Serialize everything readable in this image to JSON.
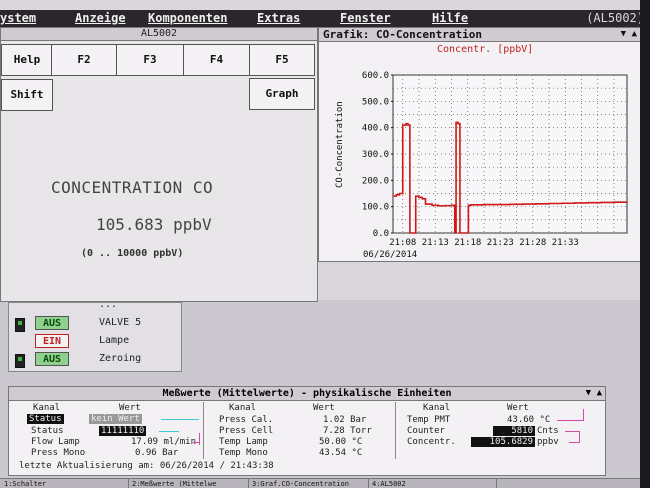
{
  "menubar": {
    "items": [
      "ystem",
      "Anzeige",
      "Komponenten",
      "Extras",
      "Fenster",
      "Hilfe"
    ],
    "right_label": "(AL5002)"
  },
  "al_window": {
    "title": "AL5002",
    "keys": [
      "Help",
      "F2",
      "F3",
      "F4",
      "F5",
      "Shift",
      "Graph"
    ],
    "concentration_label": "CONCENTRATION CO",
    "concentration_value": "105.683 ppbV",
    "range": "(0 .. 10000 ppbV)"
  },
  "valves": [
    {
      "state": "",
      "label": "...",
      "state_type": "aus"
    },
    {
      "state": "AUS",
      "label": "VALVE 5",
      "state_type": "aus"
    },
    {
      "state": "EIN",
      "label": "Lampe",
      "state_type": "ein"
    },
    {
      "state": "AUS",
      "label": "Zeroing",
      "state_type": "aus"
    }
  ],
  "chart_window": {
    "title": "Grafik: CO-Concentration",
    "subtitle": "Concentr. [ppbV]",
    "ylabel": "CO-Concentration",
    "date": "06/26/2014",
    "controls": [
      "▼",
      "▲"
    ]
  },
  "chart_data": {
    "type": "line",
    "title": "Grafik: CO-Concentration",
    "subtitle": "Concentr. [ppbV]",
    "ylabel": "CO-Concentration",
    "xlabel": "",
    "ylim": [
      0,
      600
    ],
    "yticks": [
      "0.0",
      "100.0",
      "200.0",
      "300.0",
      "400.0",
      "500.0",
      "600.0"
    ],
    "xticks": [
      "21:08",
      "21:13",
      "21:18",
      "21:23",
      "21:28",
      "21:33"
    ],
    "xlim_minutes": [
      0,
      36
    ],
    "grid": true,
    "series": [
      {
        "color": "#d01818",
        "x": [
          0,
          0.5,
          1,
          1.5,
          2,
          2.3,
          2.6,
          3.0,
          3.5,
          4.0,
          4.5,
          5,
          6,
          7,
          8,
          9,
          9.5,
          9.7,
          10.0,
          10.3,
          10.6,
          10.9,
          11.2,
          11.6,
          12,
          14,
          16,
          18,
          20,
          22,
          24,
          26,
          28,
          30,
          32,
          34,
          36
        ],
        "y": [
          140,
          145,
          150,
          410,
          415,
          410,
          0,
          0,
          140,
          135,
          130,
          110,
          105,
          103,
          104,
          105,
          0,
          420,
          415,
          0,
          0,
          0,
          0,
          105,
          107,
          108,
          108,
          109,
          110,
          111,
          112,
          113,
          114,
          115,
          116,
          117,
          118
        ]
      }
    ]
  },
  "measurement_window": {
    "title": "Meßwerte (Mittelwerte) - physikalische Einheiten",
    "col_kanal": "Kanal",
    "col_wert": "Wert",
    "col1": [
      {
        "name": "Status",
        "value": "kein Wert"
      },
      {
        "name": "Status",
        "value": "11111110"
      },
      {
        "name": "Flow Lamp",
        "value": "17.09 ml/min"
      },
      {
        "name": "Press Mono",
        "value": "0.96 Bar"
      }
    ],
    "col2": [
      {
        "name": "Press Cal.",
        "value": "1.02 Bar"
      },
      {
        "name": "Press Cell",
        "value": "7.28 Torr"
      },
      {
        "name": "Temp Lamp",
        "value": "50.00 °C"
      },
      {
        "name": "Temp Mono",
        "value": "43.54 °C"
      }
    ],
    "col3": [
      {
        "name": "Temp PMT",
        "value": "43.60 °C"
      },
      {
        "name": "Counter",
        "value": "5810",
        "unit": "Cnts"
      },
      {
        "name": "Concentr.",
        "value": "105.6829",
        "unit": "ppbv"
      }
    ],
    "footer": "letzte Aktualisierung am: 06/26/2014 / 21:43:38"
  },
  "taskbar": {
    "items": [
      "1:Schalter",
      "2:Meßwerte (Mittelwe",
      "3:Graf.CO-Concentration",
      "4:AL5002"
    ]
  },
  "colors": {
    "accent_red": "#d01818",
    "status_green": "#8fd08f",
    "lead_cyan": "#3ec8d8",
    "lead_magenta": "#d84aa8"
  }
}
